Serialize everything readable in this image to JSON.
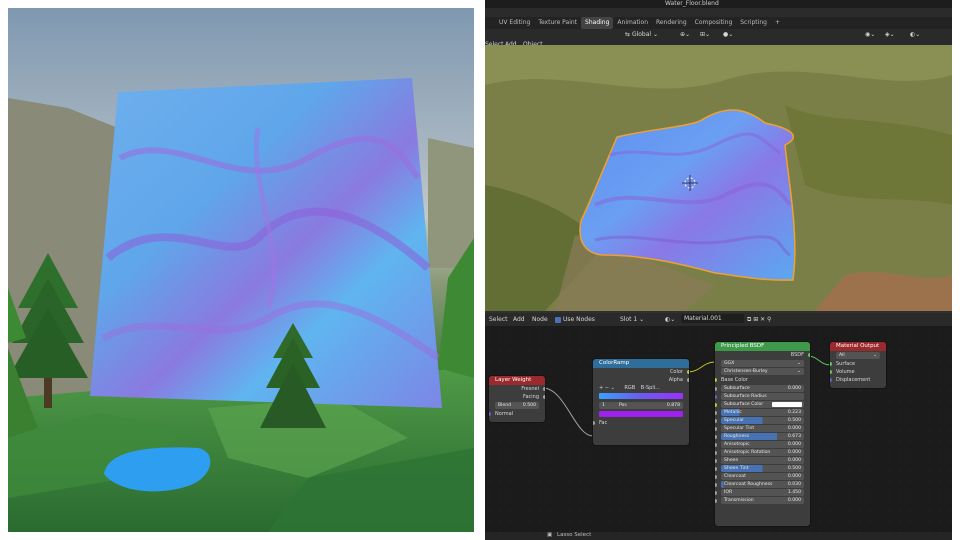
{
  "blender": {
    "title": "Water_Floor.blend",
    "tabs": [
      "UV Editing",
      "Texture Paint",
      "Shading",
      "Animation",
      "Rendering",
      "Compositing",
      "Scripting",
      "+"
    ],
    "active_tab": "Shading",
    "transform": "Global",
    "viewport_menu": [
      "Select",
      "Add",
      "Object"
    ],
    "node_menu": [
      "Select",
      "Add",
      "Node"
    ],
    "use_nodes_label": "Use Nodes",
    "slot": "Slot 1",
    "material": "Material.001",
    "status": "Lasso Select"
  },
  "nodes": {
    "layer_weight": {
      "title": "Layer Weight",
      "outputs": [
        "Fresnel",
        "Facing"
      ],
      "blend_label": "Blend",
      "blend_value": "0.500",
      "input_normal": "Normal"
    },
    "color_ramp": {
      "title": "ColorRamp",
      "outputs": [
        "Color",
        "Alpha"
      ],
      "mode": "RGB",
      "interp": "B-Spli...",
      "stop_index": "1",
      "pos_label": "Pos",
      "pos_value": "0.878",
      "input": "Fac",
      "ramp_colors": [
        "#3aa0ff",
        "#9b30ff"
      ],
      "swatch_color": "#a020f0"
    },
    "bsdf": {
      "title": "Principled BSDF",
      "output": "BSDF",
      "dist": "GGX",
      "sss": "Christensen-Burley",
      "base_color_label": "Base Color",
      "rows": [
        {
          "label": "Subsurface",
          "value": "0.000",
          "fill": 0
        },
        {
          "label": "Subsurface Radius",
          "value": "",
          "fill": 0
        },
        {
          "label": "Subsurface Color",
          "value": "",
          "fill": 0
        },
        {
          "label": "Metallic",
          "value": "0.223",
          "fill": 0.223
        },
        {
          "label": "Specular",
          "value": "0.500",
          "fill": 0.5
        },
        {
          "label": "Specular Tint",
          "value": "0.000",
          "fill": 0
        },
        {
          "label": "Roughness",
          "value": "0.673",
          "fill": 0.673
        },
        {
          "label": "Anisotropic",
          "value": "0.000",
          "fill": 0
        },
        {
          "label": "Anisotropic Rotation",
          "value": "0.000",
          "fill": 0
        },
        {
          "label": "Sheen",
          "value": "0.000",
          "fill": 0
        },
        {
          "label": "Sheen Tint",
          "value": "0.500",
          "fill": 0.5
        },
        {
          "label": "Clearcoat",
          "value": "0.000",
          "fill": 0
        },
        {
          "label": "Clearcoat Roughness",
          "value": "0.030",
          "fill": 0.03
        },
        {
          "label": "IOR",
          "value": "1.450",
          "fill": 0
        },
        {
          "label": "Transmission",
          "value": "0.000",
          "fill": 0
        }
      ]
    },
    "output": {
      "title": "Material Output",
      "target": "All",
      "inputs": [
        "Surface",
        "Volume",
        "Displacement"
      ]
    }
  },
  "colors": {
    "node_shader_head": "#3e9a4a",
    "node_converter_head": "#2f6d9a",
    "node_input_head": "#9a2a2e",
    "node_output_head": "#9a2a2e",
    "socket_yellow": "#c7c729",
    "socket_grey": "#a1a1a1",
    "socket_green": "#63c763",
    "socket_purple": "#6363c7",
    "slider_blue": "#4772b3",
    "selection_orange": "#f0a030"
  }
}
